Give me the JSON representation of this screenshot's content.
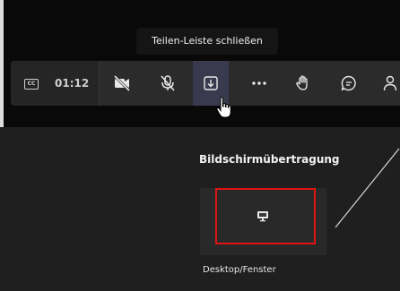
{
  "tooltip": {
    "text": "Teilen-Leiste schließen"
  },
  "toolbar": {
    "captions_icon_text": "CC",
    "time": "01:12",
    "buttons": [
      {
        "name": "camera-off",
        "icon": "video-off-icon"
      },
      {
        "name": "mic-off",
        "icon": "mic-off-icon"
      },
      {
        "name": "share-tray",
        "icon": "download-tray-icon"
      },
      {
        "name": "more",
        "icon": "more-icon"
      },
      {
        "name": "raise-hand",
        "icon": "hand-icon"
      },
      {
        "name": "chat",
        "icon": "chat-icon"
      },
      {
        "name": "people",
        "icon": "people-icon"
      }
    ]
  },
  "share_panel": {
    "title": "Bildschirmübertragung",
    "tile_label": "Desktop/Fenster"
  },
  "colors": {
    "highlight_border": "#e01414",
    "active_button": "#3a3a4f",
    "panel_bg": "#1f1f1f"
  }
}
